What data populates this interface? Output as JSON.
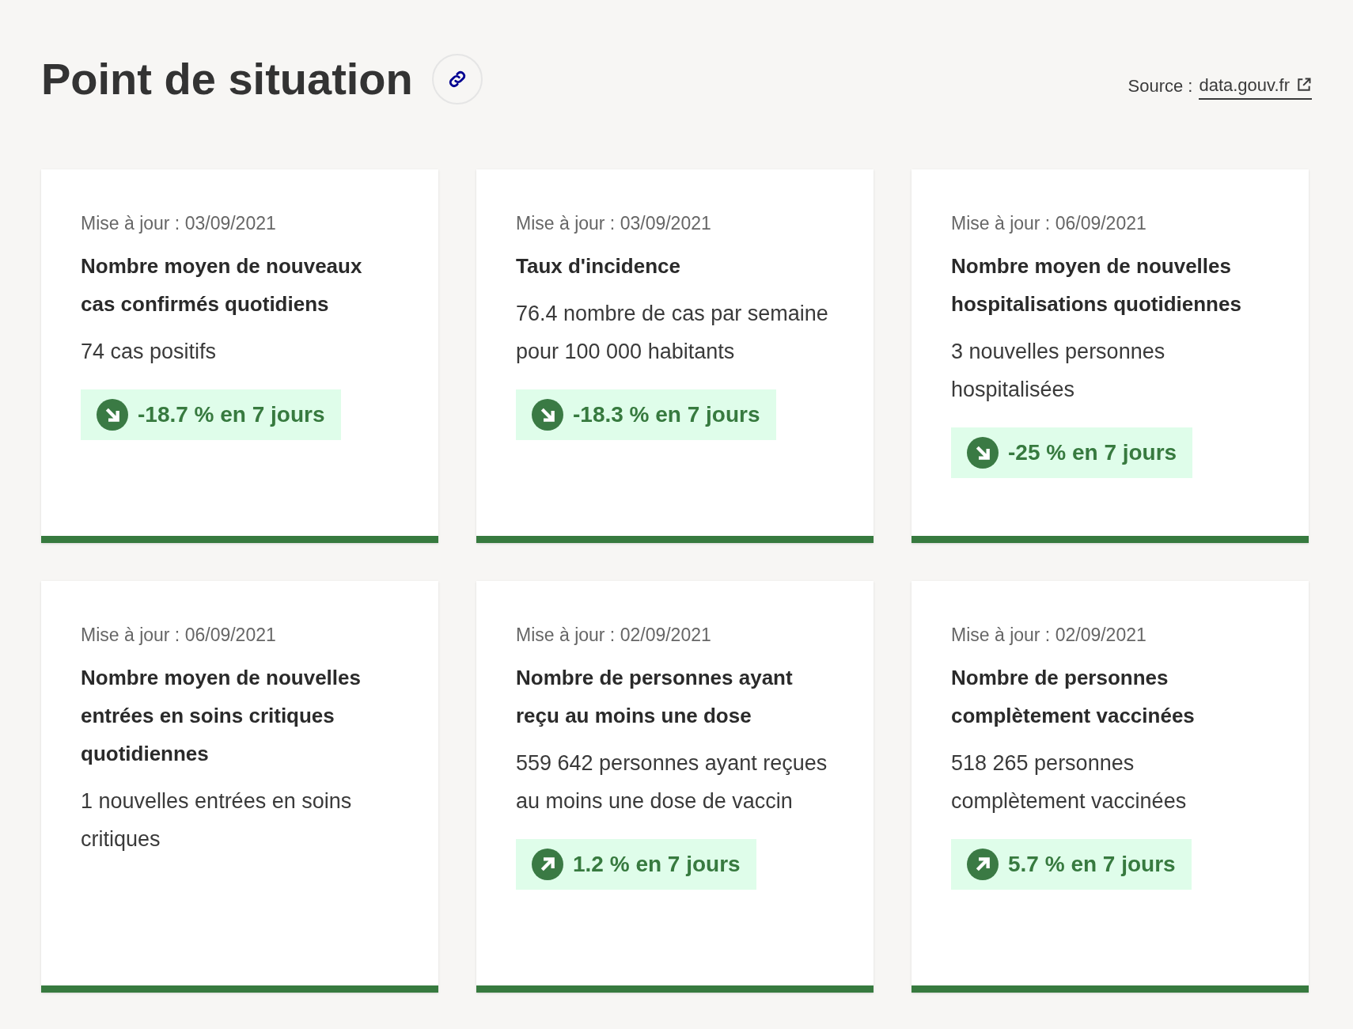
{
  "header": {
    "title": "Point de situation",
    "source_label": "Source :",
    "source_link": "data.gouv.fr"
  },
  "cards": [
    {
      "updated": "Mise à jour : 03/09/2021",
      "title": "Nombre moyen de nouveaux cas confirmés quotidiens",
      "value": "74 cas positifs",
      "trend": {
        "kind": "down",
        "label": "-18.7 % en 7 jours"
      }
    },
    {
      "updated": "Mise à jour : 03/09/2021",
      "title": "Taux d'incidence",
      "value": "76.4 nombre de cas par semaine pour 100 000 habitants",
      "trend": {
        "kind": "down",
        "label": "-18.3 % en 7 jours"
      }
    },
    {
      "updated": "Mise à jour : 06/09/2021",
      "title": "Nombre moyen de nouvelles hospitalisations quotidiennes",
      "value": "3 nouvelles personnes hospitalisées",
      "trend": {
        "kind": "down",
        "label": "-25 % en 7 jours"
      }
    },
    {
      "updated": "Mise à jour : 06/09/2021",
      "title": "Nombre moyen de nouvelles entrées en soins critiques quotidiennes",
      "value": "1 nouvelles entrées en soins critiques"
    },
    {
      "updated": "Mise à jour : 02/09/2021",
      "title": "Nombre de personnes ayant reçu au moins une dose",
      "value": "559 642 personnes ayant reçues au moins une dose de vaccin",
      "trend": {
        "kind": "up",
        "label": "1.2 % en 7 jours"
      }
    },
    {
      "updated": "Mise à jour : 02/09/2021",
      "title": "Nombre de personnes complètement vaccinées",
      "value": "518 265 personnes complètement vaccinées",
      "trend": {
        "kind": "up",
        "label": "5.7 % en 7 jours"
      }
    }
  ]
}
